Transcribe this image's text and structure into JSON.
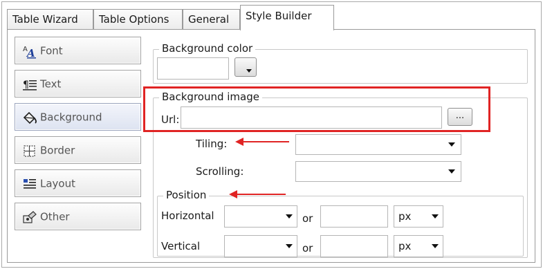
{
  "tabs": [
    {
      "label": "Table Wizard",
      "active": false
    },
    {
      "label": "Table Options",
      "active": false
    },
    {
      "label": "General",
      "active": false
    },
    {
      "label": "Style Builder",
      "active": true
    }
  ],
  "style_buttons": [
    {
      "label": "Font",
      "icon": "font-icon"
    },
    {
      "label": "Text",
      "icon": "paragraph-icon"
    },
    {
      "label": "Background",
      "icon": "paint-bucket-icon",
      "selected": true
    },
    {
      "label": "Border",
      "icon": "border-grid-icon"
    },
    {
      "label": "Layout",
      "icon": "layout-lines-icon"
    },
    {
      "label": "Other",
      "icon": "other-icon"
    }
  ],
  "background_color": {
    "legend": "Background color",
    "value": ""
  },
  "background_image": {
    "legend": "Background image",
    "url_label": "Url:",
    "url_value": "",
    "browse_label": "..."
  },
  "tiling": {
    "label": "Tiling:",
    "value": ""
  },
  "scrolling": {
    "label": "Scrolling:",
    "value": ""
  },
  "position": {
    "legend": "Position",
    "horizontal": {
      "label": "Horizontal",
      "value": "",
      "or": "or",
      "amount": "",
      "unit": "px"
    },
    "vertical": {
      "label": "Vertical",
      "value": "",
      "or": "or",
      "amount": "",
      "unit": "px"
    }
  },
  "colors": {
    "annotation": "#e02424",
    "selected": "#dde3f1"
  }
}
